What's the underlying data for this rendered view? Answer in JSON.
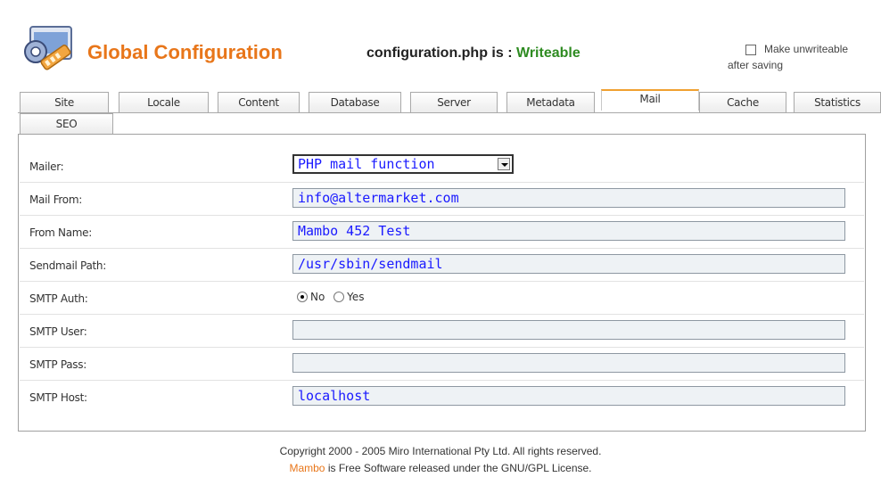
{
  "header": {
    "title": "Global Configuration",
    "status_prefix": "configuration.php is :",
    "status_value": "Writeable",
    "unwritable_line1": "Make unwriteable",
    "unwritable_line2": "after saving",
    "unwritable_checked": false
  },
  "tabs": [
    {
      "label": "Site",
      "active": false
    },
    {
      "label": "Locale",
      "active": false
    },
    {
      "label": "Content",
      "active": false
    },
    {
      "label": "Database",
      "active": false
    },
    {
      "label": "Server",
      "active": false
    },
    {
      "label": "Metadata",
      "active": false
    },
    {
      "label": "Mail",
      "active": true
    },
    {
      "label": "Cache",
      "active": false
    },
    {
      "label": "Statistics",
      "active": false
    },
    {
      "label": "SEO",
      "active": false
    }
  ],
  "form": {
    "mailer": {
      "label": "Mailer:",
      "value": "PHP mail function"
    },
    "mail_from": {
      "label": "Mail From:",
      "value": "info@altermarket.com"
    },
    "from_name": {
      "label": "From Name:",
      "value": "Mambo 452 Test"
    },
    "sendmail_path": {
      "label": "Sendmail Path:",
      "value": "/usr/sbin/sendmail"
    },
    "smtp_auth": {
      "label": "SMTP Auth:",
      "no_label": "No",
      "yes_label": "Yes",
      "selected": "No"
    },
    "smtp_user": {
      "label": "SMTP User:",
      "value": ""
    },
    "smtp_pass": {
      "label": "SMTP Pass:",
      "value": ""
    },
    "smtp_host": {
      "label": "SMTP Host:",
      "value": "localhost"
    }
  },
  "footer": {
    "line1": "Copyright 2000 - 2005 Miro International Pty Ltd. All rights reserved.",
    "brand": "Mambo",
    "line2_rest": " is Free Software released under the GNU/GPL License."
  },
  "colors": {
    "title": "#e8761a",
    "writeable": "#2e8b21",
    "field_text": "#1a1aff",
    "active_tab_accent": "#f0a030"
  }
}
